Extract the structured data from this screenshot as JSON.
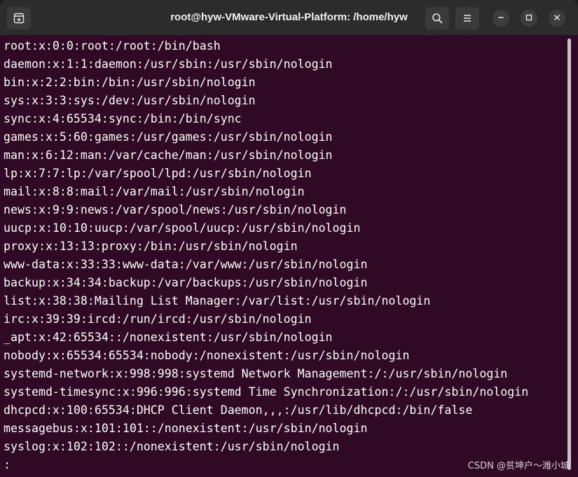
{
  "window": {
    "title": "root@hyw-VMware-Virtual-Platform: /home/hyw"
  },
  "icons": {
    "new_tab": "new-tab-icon",
    "search": "search-icon",
    "menu": "hamburger-menu-icon",
    "minimize": "minimize-icon",
    "maximize": "maximize-icon",
    "close": "close-icon"
  },
  "colors": {
    "terminal_background": "#300a24",
    "titlebar_background": "#2c2c2c",
    "text": "#ffffff"
  },
  "terminal": {
    "lines": [
      "root:x:0:0:root:/root:/bin/bash",
      "daemon:x:1:1:daemon:/usr/sbin:/usr/sbin/nologin",
      "bin:x:2:2:bin:/bin:/usr/sbin/nologin",
      "sys:x:3:3:sys:/dev:/usr/sbin/nologin",
      "sync:x:4:65534:sync:/bin:/bin/sync",
      "games:x:5:60:games:/usr/games:/usr/sbin/nologin",
      "man:x:6:12:man:/var/cache/man:/usr/sbin/nologin",
      "lp:x:7:7:lp:/var/spool/lpd:/usr/sbin/nologin",
      "mail:x:8:8:mail:/var/mail:/usr/sbin/nologin",
      "news:x:9:9:news:/var/spool/news:/usr/sbin/nologin",
      "uucp:x:10:10:uucp:/var/spool/uucp:/usr/sbin/nologin",
      "proxy:x:13:13:proxy:/bin:/usr/sbin/nologin",
      "www-data:x:33:33:www-data:/var/www:/usr/sbin/nologin",
      "backup:x:34:34:backup:/var/backups:/usr/sbin/nologin",
      "list:x:38:38:Mailing List Manager:/var/list:/usr/sbin/nologin",
      "irc:x:39:39:ircd:/run/ircd:/usr/sbin/nologin",
      "_apt:x:42:65534::/nonexistent:/usr/sbin/nologin",
      "nobody:x:65534:65534:nobody:/nonexistent:/usr/sbin/nologin",
      "systemd-network:x:998:998:systemd Network Management:/:/usr/sbin/nologin",
      "systemd-timesync:x:996:996:systemd Time Synchronization:/:/usr/sbin/nologin",
      "dhcpcd:x:100:65534:DHCP Client Daemon,,,:/usr/lib/dhcpcd:/bin/false",
      "messagebus:x:101:101::/nonexistent:/usr/sbin/nologin",
      "syslog:x:102:102::/nonexistent:/usr/sbin/nologin",
      ":"
    ]
  },
  "watermark": "CSDN @贫坤户～潍小城"
}
